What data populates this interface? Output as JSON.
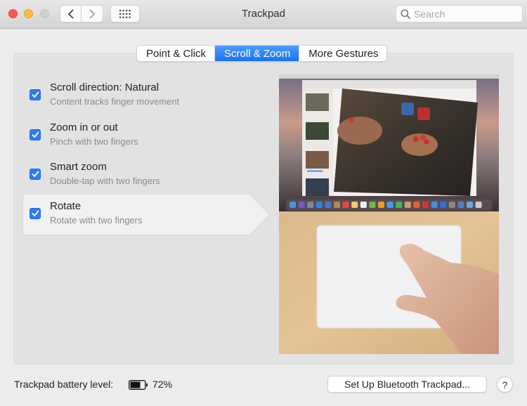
{
  "window": {
    "title": "Trackpad",
    "search_placeholder": "Search"
  },
  "titlebar_icons": {
    "close": "close-button",
    "minimize": "minimize-button",
    "zoom": "zoom-button",
    "back": "chevron-left-icon",
    "forward": "chevron-right-icon",
    "show_all": "grid-icon",
    "search": "search-icon"
  },
  "tabs": [
    {
      "label": "Point & Click",
      "active": false
    },
    {
      "label": "Scroll & Zoom",
      "active": true
    },
    {
      "label": "More Gestures",
      "active": false
    }
  ],
  "options": [
    {
      "label": "Scroll direction: Natural",
      "description": "Content tracks finger movement",
      "checked": true,
      "selected": false
    },
    {
      "label": "Zoom in or out",
      "description": "Pinch with two fingers",
      "checked": true,
      "selected": false
    },
    {
      "label": "Smart zoom",
      "description": "Double-tap with two fingers",
      "checked": true,
      "selected": false
    },
    {
      "label": "Rotate",
      "description": "Rotate with two fingers",
      "checked": true,
      "selected": true
    }
  ],
  "preview": {
    "description": "Demo video: rotating a photo in Photos on a Mac desktop using two fingers on a Magic Trackpad"
  },
  "footer": {
    "battery_label": "Trackpad battery level:",
    "battery_percent": "72%",
    "battery_level_fraction": 0.72,
    "setup_button": "Set Up Bluetooth Trackpad...",
    "help_button": "?"
  },
  "colors": {
    "accent": "#2d7cf6",
    "tab_active": "#1a74f0",
    "window_bg": "#ececec",
    "panel_bg": "#e2e2e2"
  }
}
